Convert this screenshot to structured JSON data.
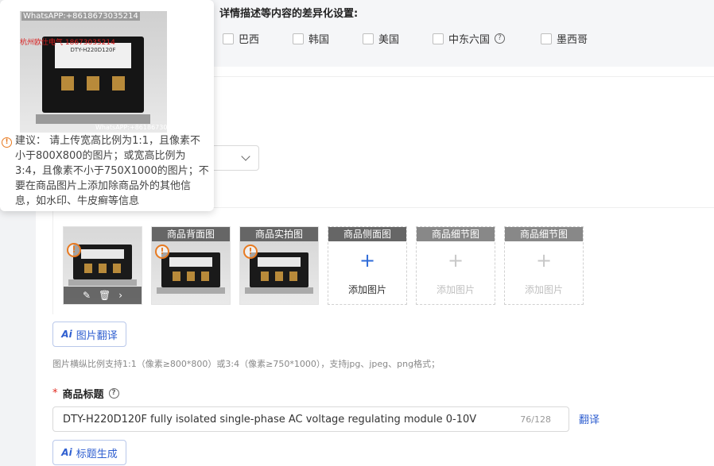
{
  "country_section": {
    "title": "详情描述等内容的差异化设置:",
    "countries": [
      "巴西",
      "韩国",
      "美国",
      "中东六国",
      "墨西哥"
    ],
    "help_glyph": "?"
  },
  "images": {
    "slot_labels": [
      "商品背面图",
      "商品实拍图",
      "商品侧面图",
      "商品细节图",
      "商品细节图"
    ],
    "add_label": "添加图片",
    "add_glyph": "+",
    "toolbar": {
      "edit_glyph": "✎",
      "delete_glyph": "🗑",
      "next_glyph": "›"
    },
    "warn_glyph": "!",
    "translate_button": "图片翻译",
    "hint": "图片横纵比例支持1:1（像素≥800*800）或3:4（像素≥750*1000），支持jpg、jpeg、png格式；"
  },
  "title_section": {
    "required_mark": "*",
    "label": "商品标题",
    "help_glyph": "?",
    "value": "DTY-H220D120F fully isolated single-phase AC voltage regulating module 0-10V",
    "count": "76/128",
    "translate_link": "翻译",
    "generate_button": "标题生成"
  },
  "ai_icon": "Ai",
  "popover": {
    "watermark": "WhatsAPP:+8618673035214",
    "watermark_bottom": "WhatsAPP:+8618673035214",
    "red_text": "杭州欧仕电气 18673035214",
    "product_label": "DTY-H220D120F",
    "icon_glyph": "!",
    "advice": "建议： 请上传宽高比例为1:1，且像素不小于800X800的图片；或宽高比例为3:4，且像素不小于750X1000的图片；不要在商品图片上添加除商品外的其他信息，如水印、牛皮癣等信息"
  },
  "colors": {
    "accent": "#2f5fd0",
    "warning": "#e87a21",
    "required": "#e0281e"
  }
}
